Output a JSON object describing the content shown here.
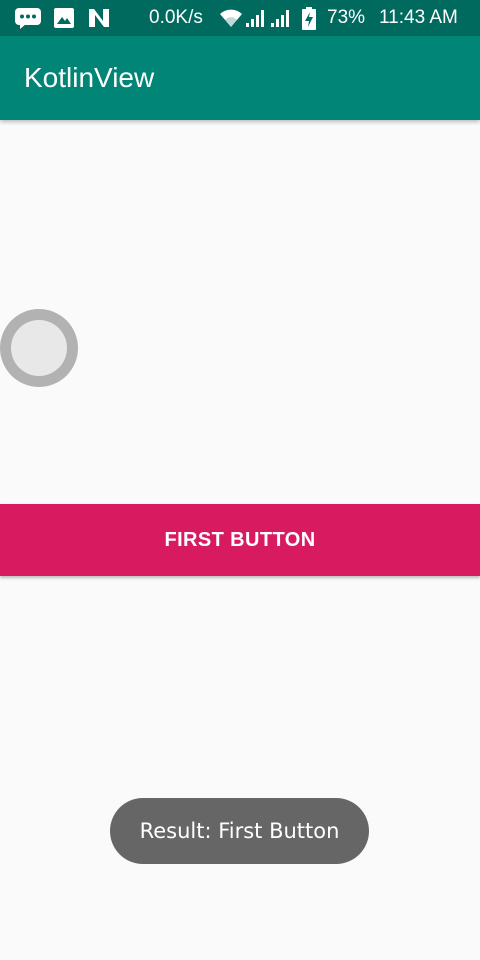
{
  "status_bar": {
    "network_speed": "0.0K/s",
    "battery_percent": "73%",
    "time": "11:43 AM",
    "icons": [
      "message-icon",
      "image-icon",
      "n-notification-icon",
      "wifi-icon",
      "signal-icon",
      "signal-icon",
      "battery-charging-icon"
    ]
  },
  "app_bar": {
    "title": "KotlinView"
  },
  "main": {
    "radio_checked": false,
    "first_button_label": "FIRST BUTTON"
  },
  "toast": {
    "message": "Result: First Button"
  },
  "colors": {
    "status_bar": "#016a5f",
    "app_bar": "#008577",
    "button": "#d81b60",
    "toast": "#666666",
    "background": "#fafafa"
  }
}
